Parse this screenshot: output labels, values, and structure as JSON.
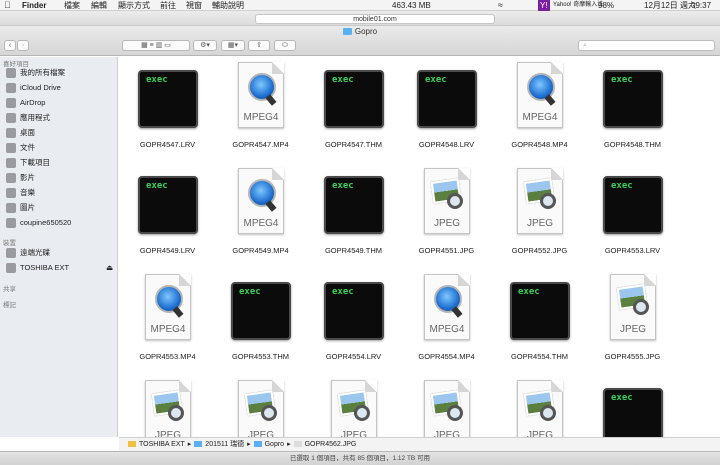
{
  "menubar": {
    "apple": "",
    "app": "Finder",
    "items": [
      "檔案",
      "編輯",
      "顯示方式",
      "前往",
      "視窗",
      "輔助說明"
    ],
    "network_speed": "463.43 MB",
    "yahoo": "Yahoo! 奇摩輸入法",
    "battery": "98%",
    "date": "12月12日 週六",
    "time": "09:37"
  },
  "browser": {
    "url": "mobile01.com"
  },
  "window": {
    "title": "Gopro",
    "search_placeholder": "",
    "back": "‹",
    "forward": "›"
  },
  "sidebar": {
    "favorites_header": "喜好項目",
    "favorites": [
      "我的所有檔案",
      "iCloud Drive",
      "AirDrop",
      "應用程式",
      "桌面",
      "文件",
      "下載項目",
      "影片",
      "音樂",
      "圖片",
      "coupine650520"
    ],
    "devices_header": "裝置",
    "devices": [
      "遠端光碟",
      "TOSHIBA EXT"
    ],
    "eject": "⏏",
    "shared_header": "共享",
    "tags_header": "標記"
  },
  "files": [
    {
      "name": "GOPR4547.LRV",
      "kind": "exec",
      "label": "exec"
    },
    {
      "name": "GOPR4547.MP4",
      "kind": "mpeg",
      "label": "MPEG4"
    },
    {
      "name": "GOPR4547.THM",
      "kind": "exec",
      "label": "exec"
    },
    {
      "name": "GOPR4548.LRV",
      "kind": "exec",
      "label": "exec"
    },
    {
      "name": "GOPR4548.MP4",
      "kind": "mpeg",
      "label": "MPEG4"
    },
    {
      "name": "GOPR4548.THM",
      "kind": "exec",
      "label": "exec"
    },
    {
      "name": "GOPR4549.LRV",
      "kind": "exec",
      "label": "exec"
    },
    {
      "name": "GOPR4549.MP4",
      "kind": "mpeg",
      "label": "MPEG4"
    },
    {
      "name": "GOPR4549.THM",
      "kind": "exec",
      "label": "exec"
    },
    {
      "name": "GOPR4551.JPG",
      "kind": "jpeg",
      "label": "JPEG"
    },
    {
      "name": "GOPR4552.JPG",
      "kind": "jpeg",
      "label": "JPEG"
    },
    {
      "name": "GOPR4553.LRV",
      "kind": "exec",
      "label": "exec"
    },
    {
      "name": "GOPR4553.MP4",
      "kind": "mpeg",
      "label": "MPEG4"
    },
    {
      "name": "GOPR4553.THM",
      "kind": "exec",
      "label": "exec"
    },
    {
      "name": "GOPR4554.LRV",
      "kind": "exec",
      "label": "exec"
    },
    {
      "name": "GOPR4554.MP4",
      "kind": "mpeg",
      "label": "MPEG4"
    },
    {
      "name": "GOPR4554.THM",
      "kind": "exec",
      "label": "exec"
    },
    {
      "name": "GOPR4555.JPG",
      "kind": "jpeg",
      "label": "JPEG"
    },
    {
      "name": "",
      "kind": "jpeg",
      "label": "JPEG"
    },
    {
      "name": "",
      "kind": "jpeg",
      "label": "JPEG"
    },
    {
      "name": "",
      "kind": "jpeg",
      "label": "JPEG"
    },
    {
      "name": "",
      "kind": "jpeg",
      "label": "JPEG"
    },
    {
      "name": "",
      "kind": "jpeg",
      "label": "JPEG"
    },
    {
      "name": "",
      "kind": "exec",
      "label": "exec"
    }
  ],
  "pathbar": {
    "items": [
      "TOSHIBA EXT",
      "201511 瑞德",
      "Gopro",
      "GOPR4562.JPG"
    ],
    "sep": "▸"
  },
  "status": "已選取 1 個項目，共有 85 個項目，1.12 TB 可用"
}
